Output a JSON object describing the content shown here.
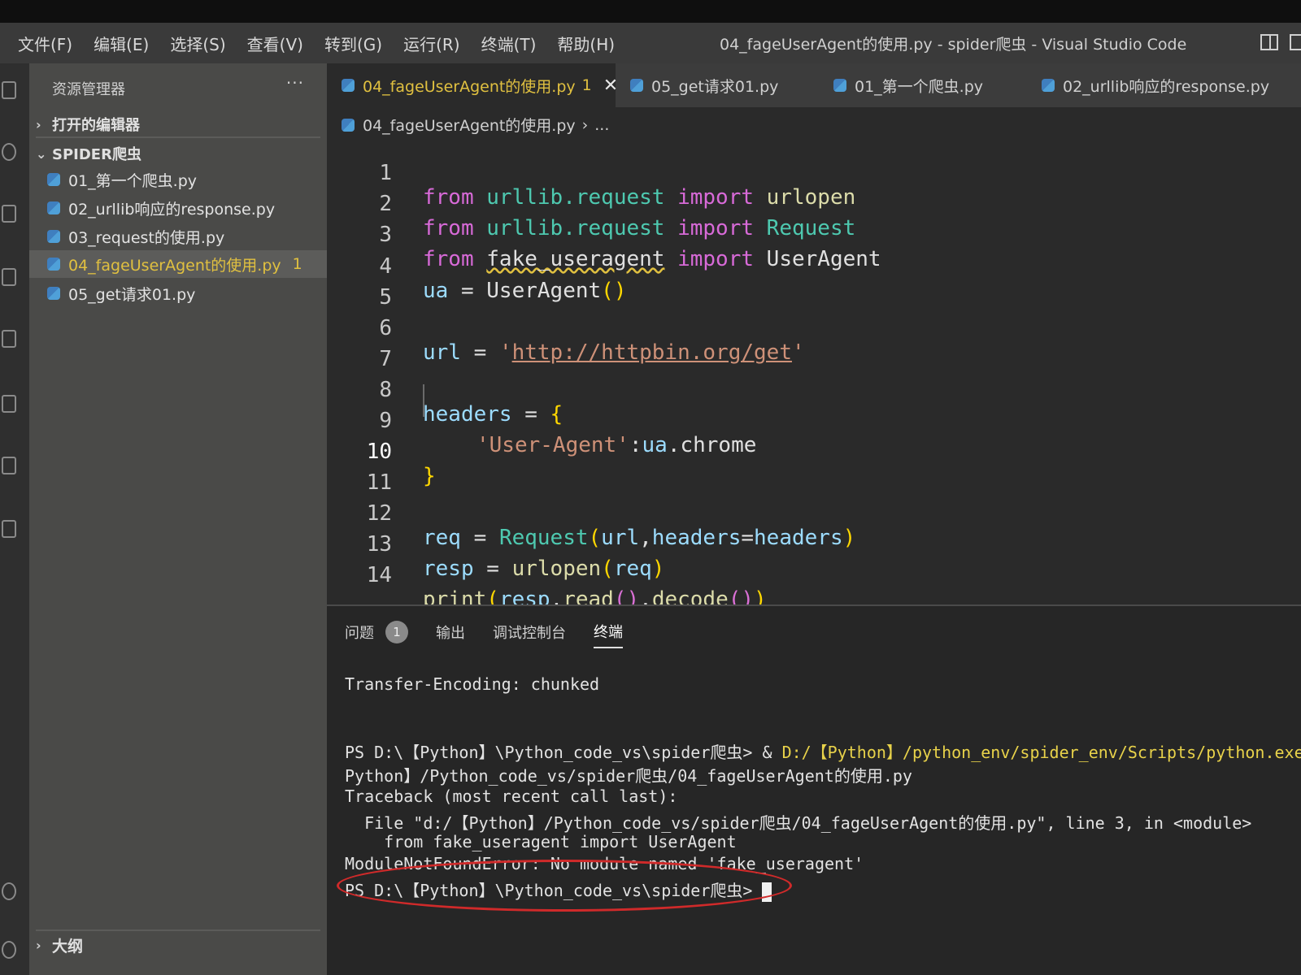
{
  "window": {
    "title": "04_fageUserAgent的使用.py - spider爬虫 - Visual Studio Code"
  },
  "menu": [
    "文件(F)",
    "编辑(E)",
    "选择(S)",
    "查看(V)",
    "转到(G)",
    "运行(R)",
    "终端(T)",
    "帮助(H)"
  ],
  "sidebar": {
    "header": "资源管理器",
    "more": "···",
    "open_editors": "打开的编辑器",
    "folder": "SPIDER爬虫",
    "files": [
      {
        "name": "01_第一个爬虫.py",
        "active": false,
        "badge": ""
      },
      {
        "name": "02_urllib响应的response.py",
        "active": false,
        "badge": ""
      },
      {
        "name": "03_request的使用.py",
        "active": false,
        "badge": ""
      },
      {
        "name": "04_fageUserAgent的使用.py",
        "active": true,
        "badge": "1"
      },
      {
        "name": "05_get请求01.py",
        "active": false,
        "badge": ""
      }
    ],
    "outline": "大纲"
  },
  "tabs": [
    {
      "label": "04_fageUserAgent的使用.py",
      "badge": "1",
      "close": "✕",
      "active": true
    },
    {
      "label": "05_get请求01.py",
      "active": false
    },
    {
      "label": "01_第一个爬虫.py",
      "active": false
    },
    {
      "label": "02_urllib响应的response.py",
      "active": false
    }
  ],
  "breadcrumb": {
    "file": "04_fageUserAgent的使用.py",
    "sep": "›",
    "rest": "..."
  },
  "code": {
    "line_numbers": [
      "1",
      "2",
      "3",
      "4",
      "5",
      "6",
      "7",
      "8",
      "9",
      "10",
      "11",
      "12",
      "13",
      "14"
    ],
    "current_line": "10",
    "l1": {
      "a": "from",
      "b": "urllib.request",
      "c": "import",
      "d": "urlopen"
    },
    "l2": {
      "a": "from",
      "b": "urllib.request",
      "c": "import",
      "d": "Request"
    },
    "l3": {
      "a": "from",
      "b": "fake_useragent",
      "c": "import",
      "d": "UserAgent"
    },
    "l4": {
      "a": "ua",
      "b": " = ",
      "c": "UserAgent",
      "d": "()"
    },
    "l6": {
      "a": "url",
      "b": " = ",
      "q1": "'",
      "c": "http://httpbin.org/get",
      "q2": "'"
    },
    "l8": {
      "a": "headers",
      "b": " = ",
      "c": "{"
    },
    "l9": {
      "a": "'User-Agent'",
      "b": ":",
      "c": "ua",
      "d": ".chrome"
    },
    "l10": {
      "a": "}"
    },
    "l12": {
      "a": "req",
      "b": " = ",
      "c": "Request",
      "d": "(",
      "e": "url",
      "f": ",",
      "g": "headers",
      "h": "=",
      "i": "headers",
      "j": ")"
    },
    "l13": {
      "a": "resp",
      "b": " = ",
      "c": "urlopen",
      "d": "(",
      "e": "req",
      "f": ")"
    },
    "l14": {
      "a": "print",
      "b": "(",
      "c": "resp",
      "d": ".",
      "e": "read",
      "f": "()",
      "g": ".",
      "h": "decode",
      "i": "()",
      "j": ")"
    }
  },
  "panel": {
    "tabs": {
      "problems": "问题",
      "problems_count": "1",
      "output": "输出",
      "debug": "调试控制台",
      "terminal": "终端"
    },
    "lines": {
      "t1": "Transfer-Encoding: chunked",
      "t2a": "PS D:\\【Python】\\Python_code_vs\\spider爬虫> & ",
      "t2b": "D:/【Python】/python_env/spider_env/Scripts/python.exe",
      "t3": "Python】/Python_code_vs/spider爬虫/04_fageUserAgent的使用.py",
      "t4": "Traceback (most recent call last):",
      "t5": "  File \"d:/【Python】/Python_code_vs/spider爬虫/04_fageUserAgent的使用.py\", line 3, in <module>",
      "t6": "    from fake_useragent import UserAgent",
      "t7": "ModuleNotFoundError: No module named 'fake_useragent'",
      "t8": "PS D:\\【Python】\\Python_code_vs\\spider爬虫> "
    }
  }
}
